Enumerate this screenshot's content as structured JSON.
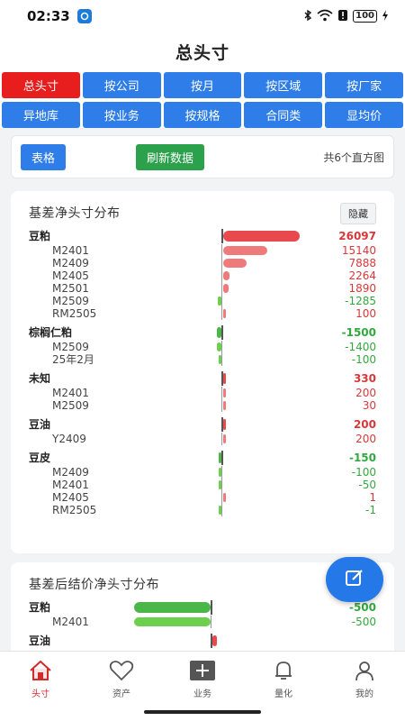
{
  "status": {
    "time": "02:33",
    "battery": "100"
  },
  "title": "总头寸",
  "tabs": [
    "总头寸",
    "按公司",
    "按月",
    "按区域",
    "按厂家",
    "异地库",
    "按业务",
    "按规格",
    "合同类",
    "显均价"
  ],
  "toolbar": {
    "table_label": "表格",
    "refresh_label": "刷新数据",
    "chart_count": "共6个直方图"
  },
  "colors": {
    "accent": "#2e7de8",
    "active_tab": "#e81d1d",
    "refresh": "#2aa14a",
    "positive": "#d9383a",
    "negative": "#33a83e"
  },
  "card1": {
    "title": "基差净头寸分布",
    "hide_label": "隐藏",
    "rows": [
      {
        "kind": "group",
        "label": "豆粕",
        "value": "26097",
        "num": 26097
      },
      {
        "kind": "sub",
        "label": "M2401",
        "value": "15140",
        "num": 15140
      },
      {
        "kind": "sub",
        "label": "M2409",
        "value": "7888",
        "num": 7888
      },
      {
        "kind": "sub",
        "label": "M2405",
        "value": "2264",
        "num": 2264
      },
      {
        "kind": "sub",
        "label": "M2501",
        "value": "1890",
        "num": 1890
      },
      {
        "kind": "sub",
        "label": "M2509",
        "value": "-1285",
        "num": -1285
      },
      {
        "kind": "sub",
        "label": "RM2505",
        "value": "100",
        "num": 100
      },
      {
        "kind": "group",
        "label": "棕榈仁粕",
        "value": "-1500",
        "num": -1500
      },
      {
        "kind": "sub",
        "label": "M2509",
        "value": "-1400",
        "num": -1400
      },
      {
        "kind": "sub",
        "label": "25年2月",
        "value": "-100",
        "num": -100
      },
      {
        "kind": "group",
        "label": "未知",
        "value": "330",
        "num": 330
      },
      {
        "kind": "sub",
        "label": "M2401",
        "value": "200",
        "num": 200
      },
      {
        "kind": "sub",
        "label": "M2509",
        "value": "30",
        "num": 30
      },
      {
        "kind": "group",
        "label": "豆油",
        "value": "200",
        "num": 200
      },
      {
        "kind": "sub",
        "label": "Y2409",
        "value": "200",
        "num": 200
      },
      {
        "kind": "group",
        "label": "豆皮",
        "value": "-150",
        "num": -150
      },
      {
        "kind": "sub",
        "label": "M2409",
        "value": "-100",
        "num": -100
      },
      {
        "kind": "sub",
        "label": "M2401",
        "value": "-50",
        "num": -50
      },
      {
        "kind": "sub",
        "label": "M2405",
        "value": "1",
        "num": 1
      },
      {
        "kind": "sub",
        "label": "RM2505",
        "value": "-1",
        "num": -1
      }
    ]
  },
  "card2": {
    "title": "基差后结价净头寸分布",
    "rows": [
      {
        "kind": "group",
        "label": "豆粕",
        "value": "-500",
        "num": -500
      },
      {
        "kind": "sub",
        "label": "M2401",
        "value": "-500",
        "num": -500
      },
      {
        "kind": "group",
        "label": "豆油",
        "value": "",
        "num": 30
      }
    ]
  },
  "nav": [
    {
      "label": "头寸",
      "icon": "home-icon"
    },
    {
      "label": "资产",
      "icon": "heart-icon"
    },
    {
      "label": "业务",
      "icon": "plus-icon"
    },
    {
      "label": "量化",
      "icon": "bell-icon"
    },
    {
      "label": "我的",
      "icon": "user-icon"
    }
  ]
}
